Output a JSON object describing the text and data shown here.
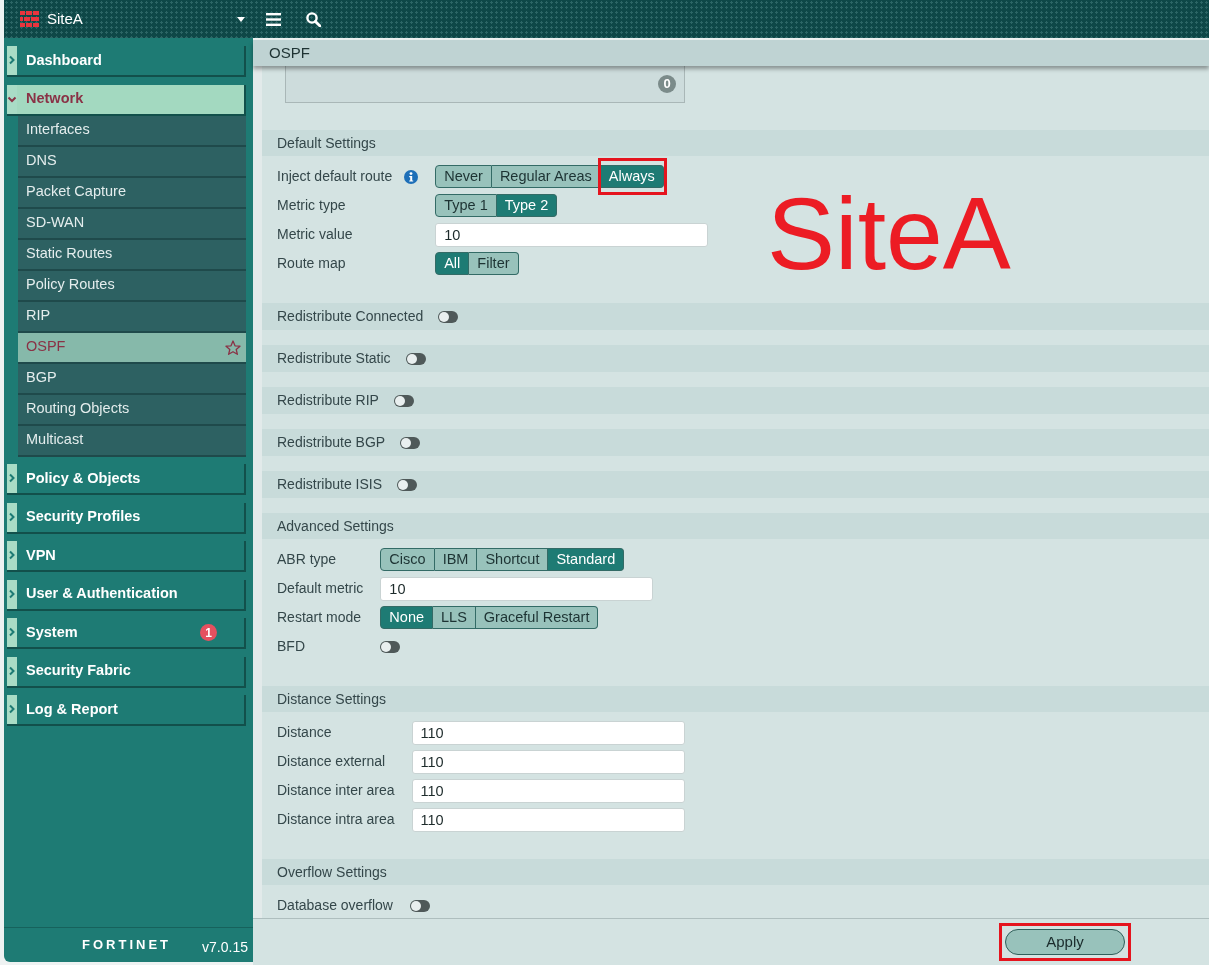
{
  "top_bar": {
    "site_name": "SiteA"
  },
  "sidebar": {
    "items": [
      {
        "label": "Dashboard",
        "expanded": false
      },
      {
        "label": "Network",
        "expanded": true,
        "children": [
          {
            "label": "Interfaces",
            "selected": false
          },
          {
            "label": "DNS",
            "selected": false
          },
          {
            "label": "Packet Capture",
            "selected": false
          },
          {
            "label": "SD-WAN",
            "selected": false
          },
          {
            "label": "Static Routes",
            "selected": false
          },
          {
            "label": "Policy Routes",
            "selected": false
          },
          {
            "label": "RIP",
            "selected": false
          },
          {
            "label": "OSPF",
            "selected": true
          },
          {
            "label": "BGP",
            "selected": false
          },
          {
            "label": "Routing Objects",
            "selected": false
          },
          {
            "label": "Multicast",
            "selected": false
          }
        ]
      },
      {
        "label": "Policy & Objects",
        "expanded": false
      },
      {
        "label": "Security Profiles",
        "expanded": false
      },
      {
        "label": "VPN",
        "expanded": false
      },
      {
        "label": "User & Authentication",
        "expanded": false
      },
      {
        "label": "System",
        "expanded": false,
        "badge": "1"
      },
      {
        "label": "Security Fabric",
        "expanded": false
      },
      {
        "label": "Log & Report",
        "expanded": false
      }
    ],
    "footer": {
      "logo": "FORTINET",
      "version": "v7.0.15"
    }
  },
  "page": {
    "title": "OSPF",
    "list_panel": {
      "count": "0"
    },
    "sections": [
      {
        "kind": "form",
        "title": "Default Settings",
        "rows": [
          {
            "kind": "segmented",
            "label": "Inject default route",
            "info": true,
            "options": [
              {
                "label": "Never",
                "selected": false,
                "highlighted": false
              },
              {
                "label": "Regular Areas",
                "selected": false,
                "highlighted": false
              },
              {
                "label": "Always",
                "selected": true,
                "highlighted": true
              }
            ]
          },
          {
            "kind": "segmented",
            "label": "Metric type",
            "options": [
              {
                "label": "Type 1",
                "selected": false,
                "highlighted": false
              },
              {
                "label": "Type 2",
                "selected": true,
                "highlighted": false
              }
            ]
          },
          {
            "kind": "input",
            "label": "Metric value",
            "value": "10"
          },
          {
            "kind": "segmented",
            "label": "Route map",
            "options": [
              {
                "label": "All",
                "selected": true,
                "highlighted": false
              },
              {
                "label": "Filter",
                "selected": false,
                "highlighted": false
              }
            ]
          }
        ]
      },
      {
        "kind": "toggle",
        "title": "Redistribute Connected",
        "on": false
      },
      {
        "kind": "toggle",
        "title": "Redistribute Static",
        "on": false
      },
      {
        "kind": "toggle",
        "title": "Redistribute RIP",
        "on": false
      },
      {
        "kind": "toggle",
        "title": "Redistribute BGP",
        "on": false
      },
      {
        "kind": "toggle",
        "title": "Redistribute ISIS",
        "on": false
      },
      {
        "kind": "form",
        "title": "Advanced Settings",
        "rows": [
          {
            "kind": "segmented",
            "label": "ABR type",
            "options": [
              {
                "label": "Cisco",
                "selected": false,
                "highlighted": false
              },
              {
                "label": "IBM",
                "selected": false,
                "highlighted": false
              },
              {
                "label": "Shortcut",
                "selected": false,
                "highlighted": false
              },
              {
                "label": "Standard",
                "selected": true,
                "highlighted": false
              }
            ]
          },
          {
            "kind": "input",
            "label": "Default metric",
            "value": "10"
          },
          {
            "kind": "segmented",
            "label": "Restart mode",
            "options": [
              {
                "label": "None",
                "selected": true,
                "highlighted": false
              },
              {
                "label": "LLS",
                "selected": false,
                "highlighted": false
              },
              {
                "label": "Graceful Restart",
                "selected": false,
                "highlighted": false
              }
            ]
          },
          {
            "kind": "toggle",
            "label": "BFD",
            "on": false
          }
        ]
      },
      {
        "kind": "form",
        "title": "Distance Settings",
        "rows": [
          {
            "kind": "input",
            "label": "Distance",
            "value": "110"
          },
          {
            "kind": "input",
            "label": "Distance external",
            "value": "110"
          },
          {
            "kind": "input",
            "label": "Distance inter area",
            "value": "110"
          },
          {
            "kind": "input",
            "label": "Distance intra area",
            "value": "110"
          }
        ]
      },
      {
        "kind": "form",
        "title": "Overflow Settings",
        "rows": [
          {
            "kind": "toggle",
            "label": "Database overflow",
            "on": false
          }
        ]
      }
    ]
  },
  "footer": {
    "buttons": [
      {
        "label": "Apply",
        "highlighted": true
      }
    ]
  },
  "annotation": {
    "text": "SiteA"
  }
}
